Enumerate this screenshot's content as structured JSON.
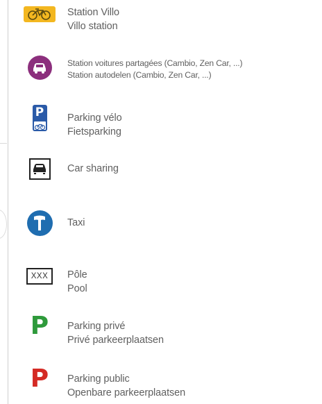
{
  "colors": {
    "villo_yellow": "#f3b720",
    "cambio_purple": "#8c2f7d",
    "bike_parking_blue": "#2a5aa8",
    "taxi_blue": "#1f6db0",
    "private_green": "#2e9a3b",
    "public_red": "#d42a24",
    "text": "#5f5f5f"
  },
  "legend": [
    {
      "icon": "villo-bike-icon",
      "line1": "Station Villo",
      "line2": "Villo station"
    },
    {
      "icon": "shared-car-icon",
      "line1": "Station voitures partagées (Cambio, Zen Car, ...)",
      "line2": "Station autodelen (Cambio, Zen Car, ...)"
    },
    {
      "icon": "bike-parking-icon",
      "icon_letter": "P",
      "line1": "Parking vélo",
      "line2": "Fietsparking"
    },
    {
      "icon": "car-sharing-icon",
      "line1": "Car sharing"
    },
    {
      "icon": "taxi-icon",
      "line1": "Taxi"
    },
    {
      "icon": "pool-box-icon",
      "icon_text": "XXX",
      "line1": "Pôle",
      "line2": "Pool"
    },
    {
      "icon": "private-parking-icon",
      "icon_letter": "P",
      "line1": "Parking privé",
      "line2": "Privé parkeerplaatsen"
    },
    {
      "icon": "public-parking-icon",
      "icon_letter": "P",
      "line1": "Parking public",
      "line2": "Openbare parkeerplaatsen"
    }
  ]
}
